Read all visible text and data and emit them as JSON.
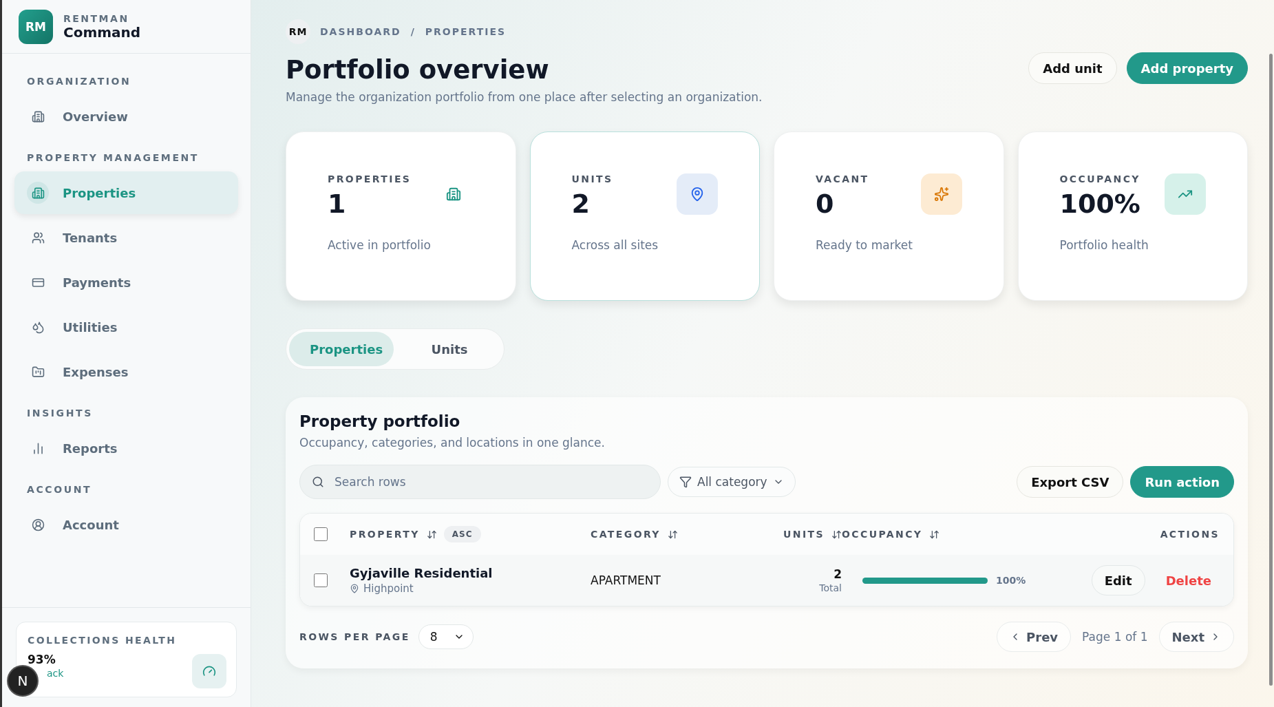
{
  "brand": {
    "logo": "RM",
    "eyebrow": "RENTMAN",
    "name": "Command"
  },
  "sidebar": {
    "sections": [
      {
        "title": "ORGANIZATION",
        "items": [
          {
            "label": "Overview",
            "selected": false
          }
        ]
      },
      {
        "title": "PROPERTY MANAGEMENT",
        "items": [
          {
            "label": "Properties",
            "selected": true
          },
          {
            "label": "Tenants",
            "selected": false
          },
          {
            "label": "Payments",
            "selected": false
          },
          {
            "label": "Utilities",
            "selected": false
          },
          {
            "label": "Expenses",
            "selected": false
          }
        ]
      },
      {
        "title": "INSIGHTS",
        "items": [
          {
            "label": "Reports",
            "selected": false
          }
        ]
      },
      {
        "title": "ACCOUNT",
        "items": [
          {
            "label": "Account",
            "selected": false
          }
        ]
      }
    ],
    "health": {
      "title": "COLLECTIONS HEALTH",
      "value": "93%",
      "link": "ack",
      "badge": "N"
    }
  },
  "breadcrumb": {
    "badge": "RM",
    "path": [
      "DASHBOARD",
      "PROPERTIES"
    ],
    "separator": "/"
  },
  "header": {
    "title": "Portfolio overview",
    "subtitle": "Manage the organization portfolio from one place after selecting an organization.",
    "actions": [
      {
        "label": "Add unit",
        "kind": "secondary"
      },
      {
        "label": "Add property",
        "kind": "primary"
      }
    ]
  },
  "stats": [
    {
      "label": "PROPERTIES",
      "value": "1",
      "note": "Active in portfolio",
      "color": "#ffffff",
      "selected": false
    },
    {
      "label": "UNITS",
      "value": "2",
      "note": "Across all sites",
      "color": "#e4ecf8",
      "selected": true
    },
    {
      "label": "VACANT",
      "value": "0",
      "note": "Ready to market",
      "color": "#fdebd3",
      "selected": false
    },
    {
      "label": "OCCUPANCY",
      "value": "100%",
      "note": "Portfolio health",
      "color": "#d6f1ea",
      "selected": false
    }
  ],
  "tabs": [
    {
      "label": "Properties",
      "selected": true
    },
    {
      "label": "Units",
      "selected": false
    }
  ],
  "portfolio": {
    "title": "Property portfolio",
    "subtitle": "Occupancy, categories, and locations in one glance.",
    "search": {
      "placeholder": "Search rows"
    },
    "filter": "All category",
    "actions": [
      {
        "label": "Export CSV",
        "kind": "secondary"
      },
      {
        "label": "Run action",
        "kind": "primary"
      }
    ],
    "table": {
      "select_all": false,
      "columns": [
        {
          "label": "PROPERTY",
          "sortable": true,
          "badge": "ASC"
        },
        {
          "label": "CATEGORY",
          "sortable": true
        },
        {
          "label": "UNITS",
          "sortable": true
        },
        {
          "label": "OCCUPANCY",
          "sortable": true
        },
        {
          "label": "ACTIONS",
          "sortable": false
        }
      ],
      "rows": [
        {
          "checked": false,
          "name": "Gyjaville Residential",
          "location": "Highpoint",
          "category": "APARTMENT",
          "units": "2",
          "units_note": "Total",
          "level": 1,
          "occupancy": "100%",
          "edit": "Edit",
          "delete": "Delete"
        }
      ]
    },
    "footer": {
      "rows_label": "ROWS PER PAGE",
      "rows_value": "8",
      "prev": "Prev",
      "page": "Page 1 of 1",
      "next": "Next"
    }
  }
}
